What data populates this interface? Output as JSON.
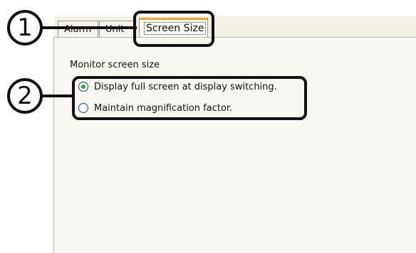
{
  "tabs": [
    {
      "label": "Alarm"
    },
    {
      "label": "Unit"
    },
    {
      "label": "Screen Size"
    }
  ],
  "section": {
    "title": "Monitor screen size"
  },
  "options": [
    {
      "label": "Display full screen at display switching.",
      "selected": true
    },
    {
      "label": "Maintain magnification factor.",
      "selected": false
    }
  ],
  "callouts": [
    {
      "number": "1"
    },
    {
      "number": "2"
    }
  ],
  "colors": {
    "active_tab_accent": "#f1a52d",
    "radio_selected": "#22b03a",
    "callout": "#111111"
  }
}
